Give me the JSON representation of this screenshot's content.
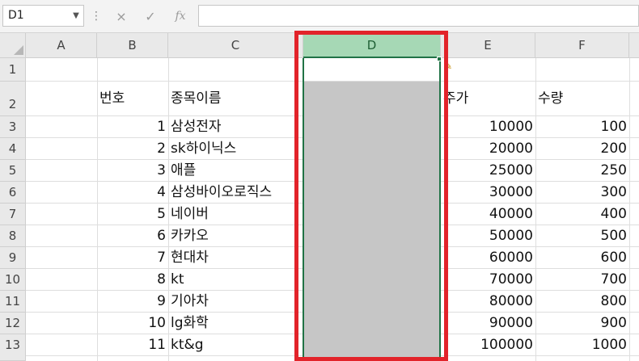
{
  "formula_bar": {
    "name_box": "D1",
    "cancel_icon": "×",
    "enter_icon": "✓",
    "function_icon": "fx",
    "formula_value": ""
  },
  "columns": [
    "A",
    "B",
    "C",
    "D",
    "E",
    "F"
  ],
  "selected_column": "D",
  "row_numbers": [
    "1",
    "2",
    "3",
    "4",
    "5",
    "6",
    "7",
    "8",
    "9",
    "10",
    "11",
    "12",
    "13"
  ],
  "header_row": {
    "b": "번호",
    "c": "종목이름",
    "e": "주가",
    "f": "수량"
  },
  "rows": [
    {
      "num": "1",
      "name": "삼성전자",
      "price": "10000",
      "qty": "100"
    },
    {
      "num": "2",
      "name": "sk하이닉스",
      "price": "20000",
      "qty": "200"
    },
    {
      "num": "3",
      "name": "애플",
      "price": "25000",
      "qty": "250"
    },
    {
      "num": "4",
      "name": "삼성바이오로직스",
      "price": "30000",
      "qty": "300"
    },
    {
      "num": "5",
      "name": "네이버",
      "price": "40000",
      "qty": "400"
    },
    {
      "num": "6",
      "name": "카카오",
      "price": "50000",
      "qty": "500"
    },
    {
      "num": "7",
      "name": "현대차",
      "price": "60000",
      "qty": "600"
    },
    {
      "num": "8",
      "name": "kt",
      "price": "70000",
      "qty": "700"
    },
    {
      "num": "9",
      "name": "기아차",
      "price": "80000",
      "qty": "800"
    },
    {
      "num": "10",
      "name": "lg화학",
      "price": "90000",
      "qty": "900"
    },
    {
      "num": "11",
      "name": "kt&g",
      "price": "100000",
      "qty": "1000"
    }
  ],
  "colors": {
    "selection_green": "#217346",
    "header_selected": "#a6d8b5",
    "highlight_red": "#e2232a",
    "selected_fill": "#c6c6c6"
  },
  "icons": {
    "paste_options": "paste-options-icon"
  }
}
